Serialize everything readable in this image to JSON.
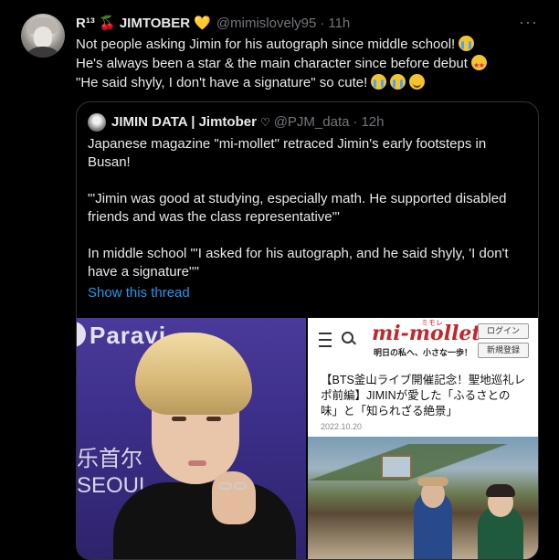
{
  "tweet": {
    "display_name": "R¹³ 🍒 JIMTOBER 💛",
    "handle": "@mimislovely95",
    "separator": "·",
    "time": "11h",
    "more_icon": "···",
    "lines": [
      "Not people asking Jimin for his autograph since middle school!",
      "He's always been a star & the main character since before debut",
      "\"He said shyly, I don't have a signature\" so cute!"
    ]
  },
  "quote": {
    "display_name": "JIMIN DATA | Jimtober",
    "heart": "♡",
    "handle": "@PJM_data",
    "separator": "·",
    "time": "12h",
    "paragraphs": [
      "Japanese magazine \"mi-mollet\" retraced Jimin's early footsteps in Busan!",
      "\"'Jimin was good at studying, especially math. He supported disabled friends and was the class representative'\"",
      "In middle school \"'I asked for his autograph, and he said shyly, 'I don't have a signature''\""
    ],
    "show_thread": "Show this thread"
  },
  "images": {
    "left": {
      "brand": "Paravi",
      "cjk": "乐首尔",
      "seoul": "SEOUL"
    },
    "right": {
      "logo": "mi-mollet",
      "logo_sub": "ミモレ",
      "tagline": "明日の私へ、小さな一歩！",
      "login": "ログイン",
      "register": "新規登録",
      "article_lines": [
        "【BTS釜山ライブ開催記念！聖地巡礼レ",
        "ポ前編】JIMINが愛した「ふるさとの",
        "味」と「知られざる絶景」"
      ],
      "date": "2022.10.20"
    }
  }
}
